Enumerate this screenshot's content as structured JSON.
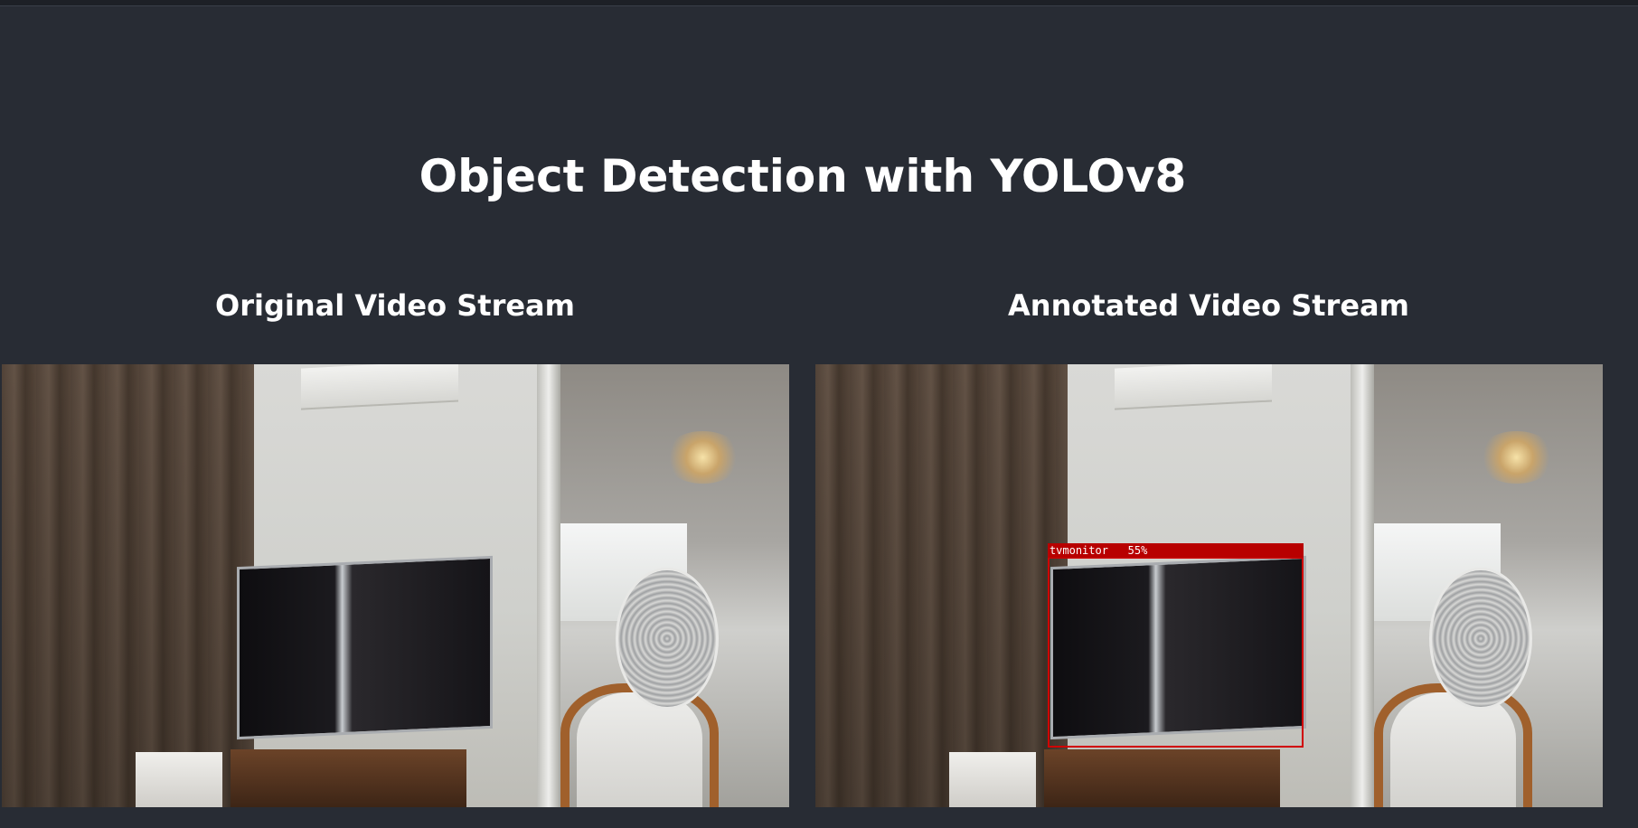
{
  "page": {
    "title": "Object Detection with YOLOv8"
  },
  "streams": {
    "original": {
      "heading": "Original Video Stream"
    },
    "annotated": {
      "heading": "Annotated Video Stream"
    }
  },
  "detections": [
    {
      "label": "tvmonitor",
      "confidence": "55%",
      "color": "#d00000"
    }
  ],
  "colors": {
    "background": "#282c34",
    "text": "#ffffff",
    "box": "#d00000"
  }
}
